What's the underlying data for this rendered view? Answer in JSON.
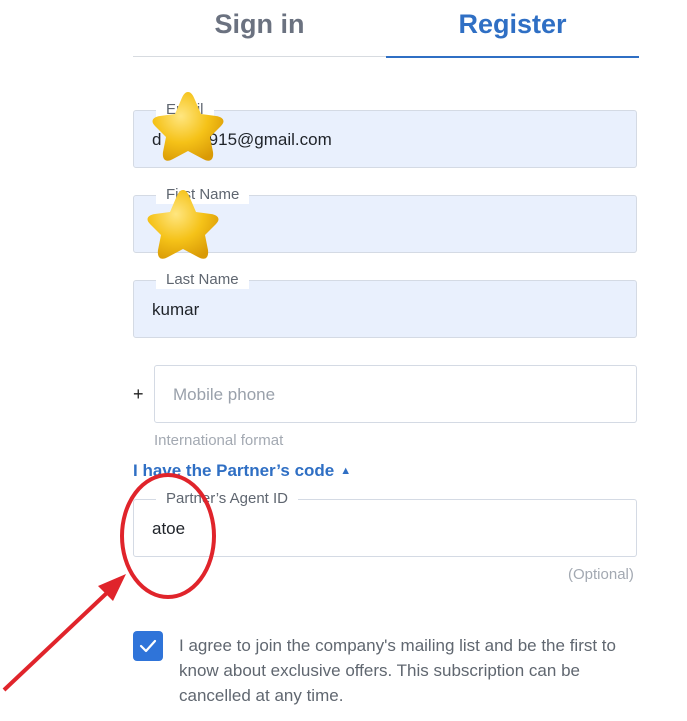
{
  "tabs": {
    "signin": "Sign in",
    "register": "Register"
  },
  "fields": {
    "email": {
      "label": "Email",
      "value": "d          915@gmail.com"
    },
    "first_name": {
      "label": "First Name",
      "value": ""
    },
    "last_name": {
      "label": "Last Name",
      "value": "kumar"
    },
    "mobile": {
      "prefix": "+",
      "placeholder": "Mobile phone",
      "hint": "International format"
    },
    "partner_id": {
      "label": "Partner’s Agent ID",
      "value": "atoe",
      "hint": "(Optional)"
    }
  },
  "partner_toggle": "I have the Partner’s code",
  "consent": {
    "checked": true,
    "text": "I agree to join the company's mailing list and be the first to know about exclusive offers. This subscription can be cancelled at any time."
  },
  "colors": {
    "accent": "#2f6fc4",
    "field_fill": "#e9f0fd",
    "annotation": "#e0242b",
    "star": "#f5c218"
  },
  "icons": {
    "caret": "caret-up-icon",
    "check": "check-icon",
    "stars": "star-icon"
  }
}
